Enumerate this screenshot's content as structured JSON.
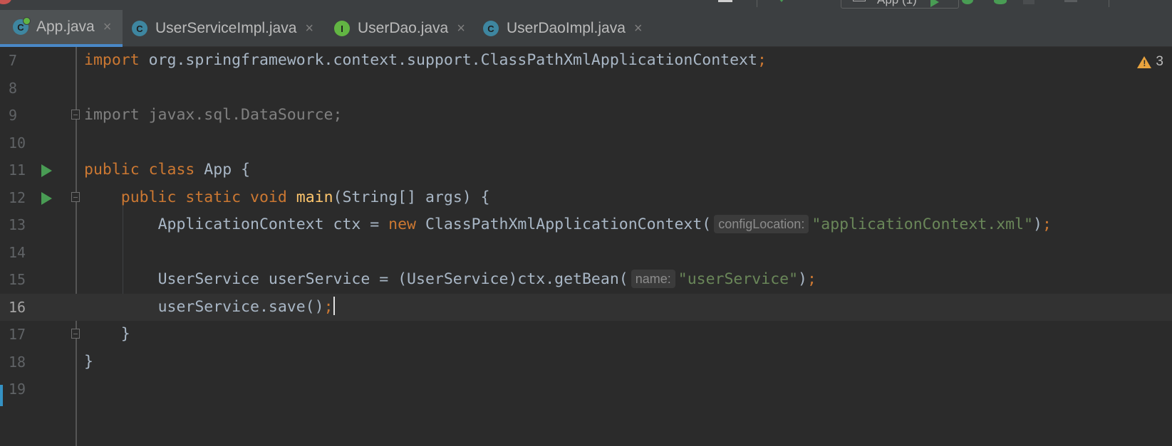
{
  "toolbar": {
    "run_config": "App (1)"
  },
  "tabs": [
    {
      "label": "App.java",
      "icon": "class-run-icon",
      "active": true
    },
    {
      "label": "UserServiceImpl.java",
      "icon": "class-icon"
    },
    {
      "label": "UserDao.java",
      "icon": "interface-icon"
    },
    {
      "label": "UserDaoImpl.java",
      "icon": "class-icon"
    }
  ],
  "icons": {
    "class_letter": "C",
    "interface_letter": "I",
    "close": "×"
  },
  "warnings": {
    "count": "3"
  },
  "gutter": {
    "line_numbers": [
      "7",
      "8",
      "9",
      "10",
      "11",
      "12",
      "13",
      "14",
      "15",
      "16",
      "17",
      "18",
      "19"
    ]
  },
  "code": {
    "l7": {
      "kw": "import",
      "rest": " org.springframework.context.support.ClassPathXmlApplicationContext",
      "semi": ";"
    },
    "l9": {
      "text": "import javax.sql.DataSource;"
    },
    "l11": {
      "kw1": "public",
      "kw2": "class",
      "rest": " App {"
    },
    "l12": {
      "kw1": "public",
      "kw2": "static",
      "kw3": "void",
      "fn": "main",
      "rest": "(String[] args) {"
    },
    "l13": {
      "pre": "ApplicationContext ctx = ",
      "kw": "new",
      "mid": " ClassPathXmlApplicationContext(",
      "hint": "configLocation:",
      "str": "\"applicationContext.xml\"",
      "end": ")",
      "semi": ";"
    },
    "l15": {
      "pre": "UserService userService = (UserService)ctx.getBean(",
      "hint": "name:",
      "str": "\"userService\"",
      "end": ")",
      "semi": ";"
    },
    "l16": {
      "pre": "userService.save()",
      "semi": ";"
    },
    "l17": {
      "text": "}"
    },
    "l18": {
      "text": "}"
    }
  },
  "colors": {
    "background": "#2b2b2b",
    "keyword": "#cc7832",
    "string": "#6a8759",
    "function": "#ffc66d",
    "text": "#a9b7c6",
    "tab_active_underline": "#4a88c7",
    "run_marker": "#499c54",
    "warning": "#e8a33e"
  }
}
